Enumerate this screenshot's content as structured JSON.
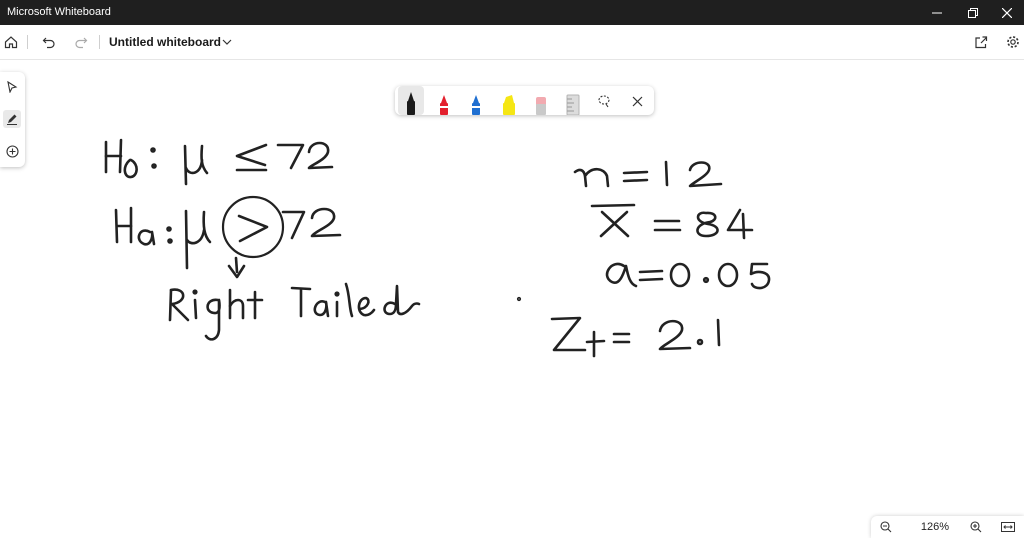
{
  "window": {
    "title": "Microsoft Whiteboard",
    "controls": [
      "minimize-icon",
      "restore-icon",
      "close-icon"
    ]
  },
  "appbar": {
    "document_title": "Untitled whiteboard",
    "left_icons": [
      "home-icon",
      "undo-icon",
      "redo-icon"
    ],
    "right_icons": [
      "share-icon",
      "settings-icon"
    ]
  },
  "left_tools": [
    "select-icon",
    "pen-icon",
    "add-icon"
  ],
  "ink_toolbar": {
    "pens": [
      {
        "name": "black-pen",
        "color": "#1a1a1a"
      },
      {
        "name": "red-pen",
        "color": "#e3202d"
      },
      {
        "name": "blue-pen",
        "color": "#1f6fd1"
      },
      {
        "name": "yellow-highlighter",
        "color": "#f5e614"
      },
      {
        "name": "eraser",
        "color": "#f2aab0"
      },
      {
        "name": "ruler",
        "color": "#d4d4d4"
      }
    ],
    "tools": [
      "lasso-icon",
      "close-icon"
    ]
  },
  "zoom": {
    "level": "126%",
    "icons": [
      "zoom-out-icon",
      "zoom-in-icon",
      "fit-to-screen-icon"
    ]
  },
  "ink_strokes": [
    "H0: μ ≤ 72",
    "Ha: μ > 72",
    "Right Tailed",
    "n = 12",
    "x̄ = 84",
    "α = 0.05",
    "Zt = 2.1"
  ]
}
